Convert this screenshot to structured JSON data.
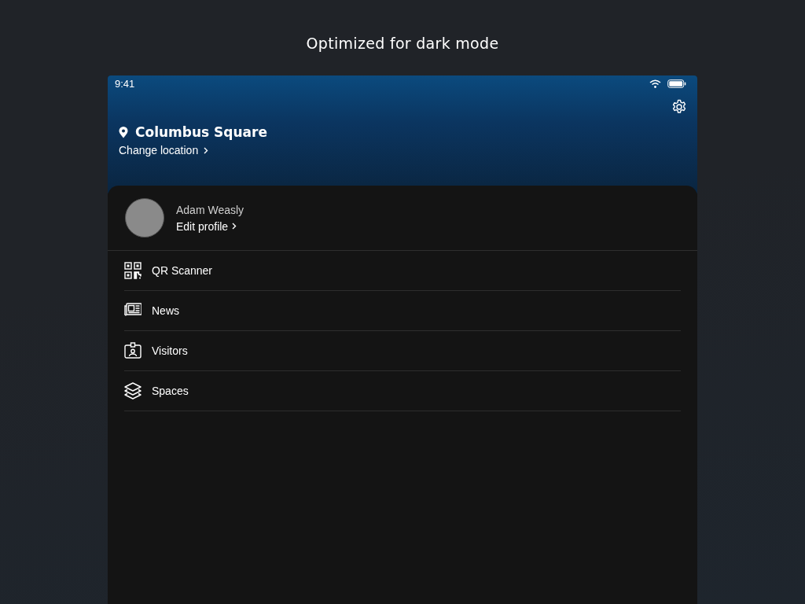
{
  "headline": "Optimized for dark mode",
  "status_bar": {
    "time": "9:41"
  },
  "header": {
    "location": "Columbus Square",
    "change_location": "Change location"
  },
  "profile": {
    "name": "Adam Weasly",
    "edit": "Edit profile"
  },
  "menu": [
    {
      "kind": "qr",
      "label": "QR Scanner"
    },
    {
      "kind": "news",
      "label": "News"
    },
    {
      "kind": "visitors",
      "label": "Visitors"
    },
    {
      "kind": "spaces",
      "label": "Spaces"
    }
  ]
}
